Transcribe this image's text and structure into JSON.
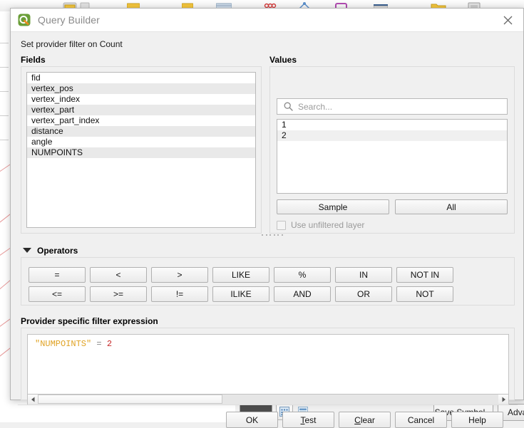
{
  "background": {
    "toolbar_name": "qgis-main-toolbar",
    "symbology_bar": {
      "color_swatch_hex": "#4d4d4d",
      "grid_view_icon": "grid-view-icon",
      "list_view_icon": "list-view-icon",
      "save_symbol_label": "Save Symbol...",
      "advanced_label": "Advan"
    }
  },
  "dialog": {
    "icon": "qgis-logo-icon",
    "title": "Query Builder",
    "close_icon": "close-icon",
    "subtitle": "Set provider filter on Count"
  },
  "fields": {
    "label": "Fields",
    "items": [
      "fid",
      "vertex_pos",
      "vertex_index",
      "vertex_part",
      "vertex_part_index",
      "distance",
      "angle",
      "NUMPOINTS"
    ]
  },
  "values": {
    "label": "Values",
    "search": {
      "icon": "search-icon",
      "placeholder": "Search...",
      "value": ""
    },
    "items": [
      "1",
      "2"
    ],
    "sample_label": "Sample",
    "all_label": "All",
    "unfiltered_label": "Use unfiltered layer",
    "unfiltered_checked": false,
    "unfiltered_enabled": false
  },
  "operators": {
    "label": "Operators",
    "collapse_icon": "chevron-down-icon",
    "expanded": true,
    "row1": [
      "=",
      "<",
      ">",
      "LIKE",
      "%",
      "IN",
      "NOT IN"
    ],
    "row2": [
      "<=",
      ">=",
      "!=",
      "ILIKE",
      "AND",
      "OR",
      "NOT"
    ]
  },
  "expression": {
    "label": "Provider specific filter expression",
    "tokens": [
      {
        "text": "\"NUMPOINTS\"",
        "kind": "field"
      },
      {
        "text": " = ",
        "kind": "op"
      },
      {
        "text": "2",
        "kind": "num"
      }
    ],
    "plain_text": "\"NUMPOINTS\" = 2",
    "colors": {
      "field": "#e0a325",
      "operator": "#858585",
      "number": "#c62828"
    },
    "scrollbar": {
      "left_arrow_icon": "arrow-left-icon",
      "right_arrow_icon": "arrow-right-icon",
      "thumb_fraction": 0.4
    }
  },
  "footer": {
    "buttons": [
      {
        "label": "OK",
        "mnemonic": ""
      },
      {
        "label": "Test",
        "mnemonic": "T"
      },
      {
        "label": "Clear",
        "mnemonic": "C"
      },
      {
        "label": "Cancel",
        "mnemonic": ""
      },
      {
        "label": "Help",
        "mnemonic": ""
      }
    ]
  }
}
